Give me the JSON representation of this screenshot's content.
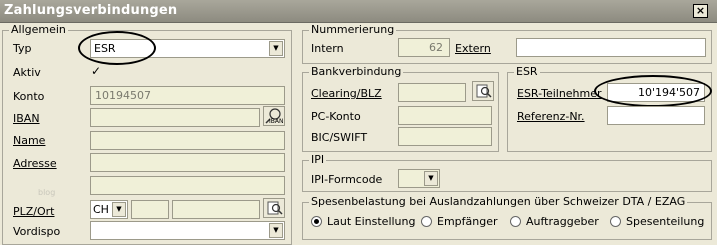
{
  "window": {
    "title": "Zahlungsverbindungen",
    "close_glyph": "×"
  },
  "allgemein": {
    "title": "Allgemein",
    "typ_label": "Typ",
    "typ_value": "ESR",
    "aktiv_label": "Aktiv",
    "aktiv_checked": true,
    "check_glyph": "✓",
    "konto_label": "Konto",
    "konto_value": "10194507",
    "iban_label": "IBAN",
    "iban_icon_text": "IBAN",
    "name_label": "Name",
    "adresse_label": "Adresse",
    "plz_label": "PLZ/Ort",
    "country_value": "CH",
    "vordispo_label": "Vordispo",
    "watermark": "blog"
  },
  "nummerierung": {
    "title": "Nummerierung",
    "intern_label": "Intern",
    "intern_value": "62",
    "extern_label": "Extern"
  },
  "bankverbindung": {
    "title": "Bankverbindung",
    "clearing_label": "Clearing/BLZ",
    "pc_label": "PC-Konto",
    "bic_label": "BIC/SWIFT"
  },
  "esr": {
    "title": "ESR",
    "teilnehmer_label": "ESR-Teilnehmer",
    "teilnehmer_value": "10'194'507",
    "referenz_label": "Referenz-Nr."
  },
  "ipi": {
    "title": "IPI",
    "formcode_label": "IPI-Formcode"
  },
  "spesen": {
    "title": "Spesenbelastung bei Auslandzahlungen über Schweizer DTA / EZAG",
    "options": [
      {
        "label": "Laut Einstellung",
        "selected": true
      },
      {
        "label": "Empfänger",
        "selected": false
      },
      {
        "label": "Auftraggeber",
        "selected": false
      },
      {
        "label": "Spesenteilung",
        "selected": false
      }
    ]
  },
  "dropdown_glyph": "▼"
}
